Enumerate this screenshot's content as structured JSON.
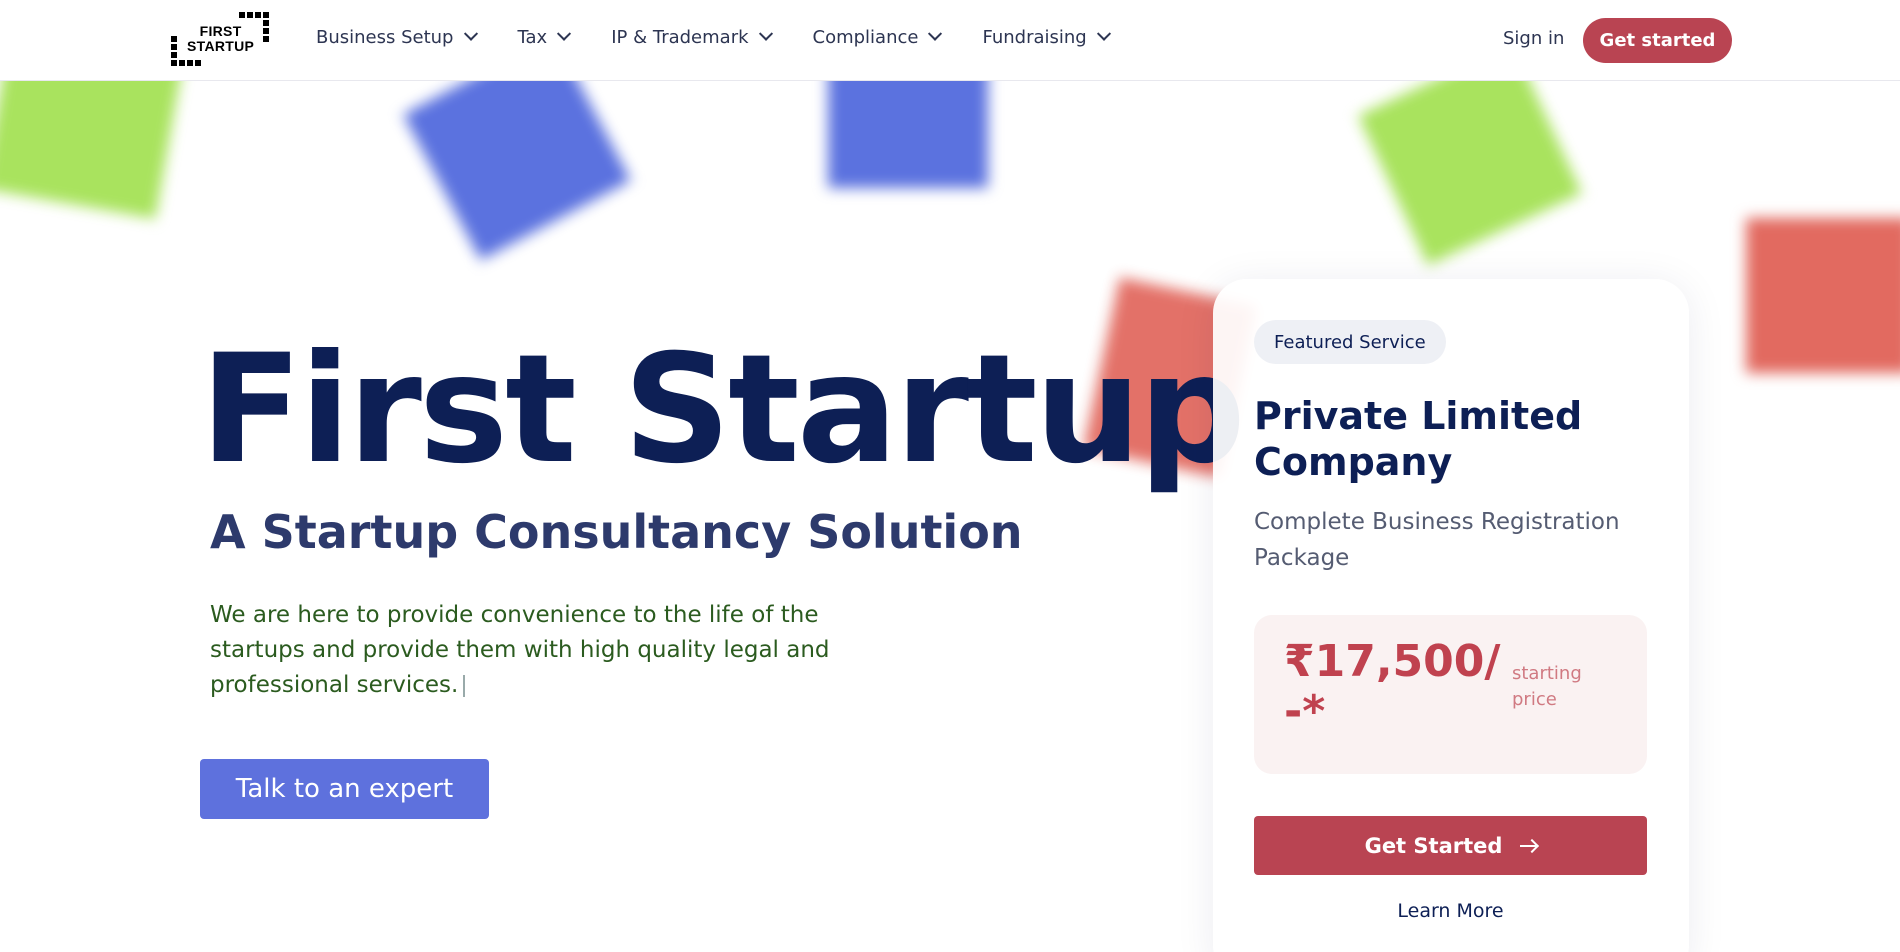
{
  "brand": {
    "logo_line1": "FIRST",
    "logo_line2": "STARTUP"
  },
  "nav": {
    "items": [
      {
        "label": "Business Setup"
      },
      {
        "label": "Tax"
      },
      {
        "label": "IP & Trademark"
      },
      {
        "label": "Compliance"
      },
      {
        "label": "Fundraising"
      }
    ],
    "sign_in": "Sign in",
    "get_started": "Get started"
  },
  "hero": {
    "title": "First Startup",
    "subtitle": "A Startup Consultancy Solution",
    "description": "We are here to provide convenience to the life of the startups and provide them with high quality legal and professional services.",
    "cta": "Talk to an expert"
  },
  "featured": {
    "badge": "Featured Service",
    "title": "Private Limited Company",
    "subtitle": "Complete Business Registration Package",
    "price": "₹17,500/-*",
    "price_note": "starting price",
    "cta": "Get Started",
    "learn_more": "Learn More"
  },
  "colors": {
    "brand_red": "#b94452",
    "brand_blue": "#5e71dd",
    "navy": "#0d1f55",
    "green_text": "#2b5b1f",
    "deco_green": "#a9e35e",
    "deco_blue": "#5b72df",
    "deco_red": "#e26a60"
  },
  "icons": [
    "chevron-down-icon",
    "arrow-right-icon"
  ]
}
